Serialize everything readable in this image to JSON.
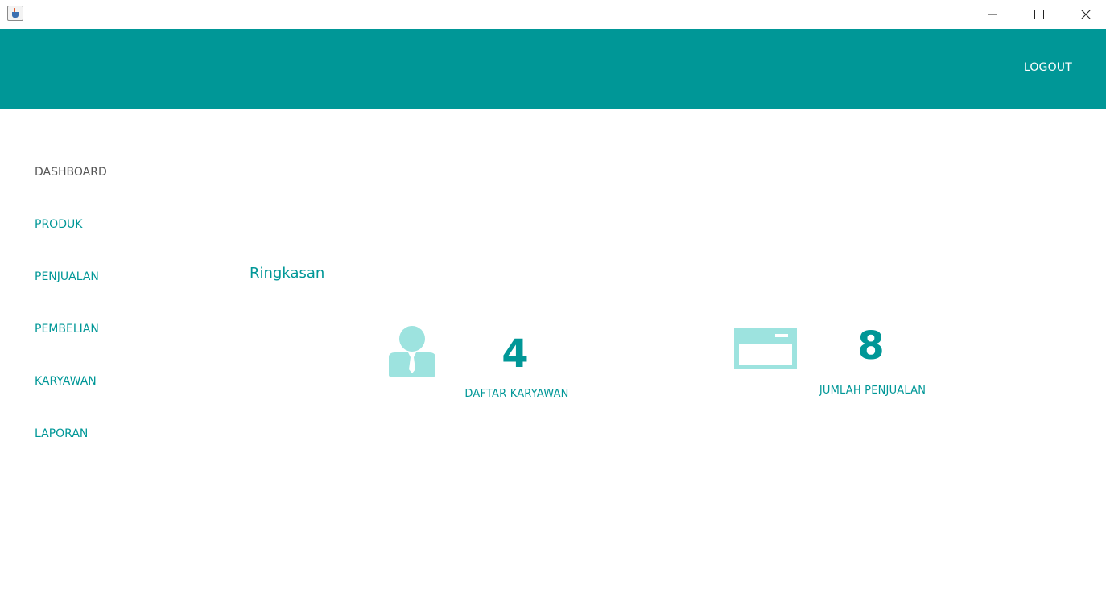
{
  "window": {
    "minimize_icon": "minimize-icon",
    "maximize_icon": "maximize-icon",
    "close_icon": "close-icon"
  },
  "header": {
    "logout_label": "LOGOUT",
    "background_color": "#009797"
  },
  "sidebar": {
    "items": [
      {
        "label": "DASHBOARD",
        "active": true
      },
      {
        "label": "PRODUK",
        "active": false
      },
      {
        "label": "PENJUALAN",
        "active": false
      },
      {
        "label": "PEMBELIAN",
        "active": false
      },
      {
        "label": "KARYAWAN",
        "active": false
      },
      {
        "label": "LAPORAN",
        "active": false
      }
    ]
  },
  "main": {
    "section_title": "Ringkasan",
    "cards": [
      {
        "icon": "employee-icon",
        "value": "4",
        "label": "DAFTAR KARYAWAN"
      },
      {
        "icon": "card-icon",
        "value": "8",
        "label": "JUMLAH PENJUALAN"
      }
    ]
  },
  "colors": {
    "accent": "#009797",
    "icon_fill": "#9de3df",
    "active_nav": "#555555"
  }
}
